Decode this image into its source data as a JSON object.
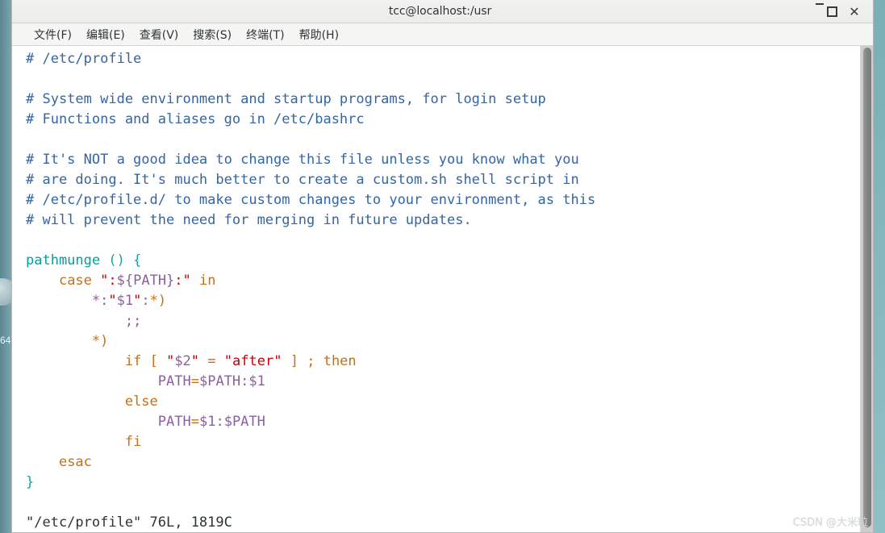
{
  "desktop": {
    "icon_label": "64",
    "icon_name": "desktop-disk-icon"
  },
  "window": {
    "title": "tcc@localhost:/usr",
    "controls": {
      "minimize": "minimize",
      "maximize": "maximize",
      "close": "close"
    }
  },
  "menu": {
    "items": [
      {
        "label": "文件(F)",
        "name": "menu-file"
      },
      {
        "label": "编辑(E)",
        "name": "menu-edit"
      },
      {
        "label": "查看(V)",
        "name": "menu-view"
      },
      {
        "label": "搜索(S)",
        "name": "menu-search"
      },
      {
        "label": "终端(T)",
        "name": "menu-terminal"
      },
      {
        "label": "帮助(H)",
        "name": "menu-help"
      }
    ]
  },
  "terminal": {
    "editor": "vim",
    "file": "/etc/profile",
    "status_line": "\"/etc/profile\" 76L, 1819C",
    "lines": [
      {
        "id": 1,
        "text": "# /etc/profile"
      },
      {
        "id": 2,
        "text": ""
      },
      {
        "id": 3,
        "text": "# System wide environment and startup programs, for login setup"
      },
      {
        "id": 4,
        "text": "# Functions and aliases go in /etc/bashrc"
      },
      {
        "id": 5,
        "text": ""
      },
      {
        "id": 6,
        "text": "# It's NOT a good idea to change this file unless you know what you"
      },
      {
        "id": 7,
        "text": "# are doing. It's much better to create a custom.sh shell script in"
      },
      {
        "id": 8,
        "text": "# /etc/profile.d/ to make custom changes to your environment, as this"
      },
      {
        "id": 9,
        "text": "# will prevent the need for merging in future updates."
      },
      {
        "id": 10,
        "text": ""
      },
      {
        "id": 11,
        "text": "pathmunge () {"
      },
      {
        "id": 12,
        "text": "    case \":${PATH}:\" in"
      },
      {
        "id": 13,
        "text": "        *:\"$1\":*)"
      },
      {
        "id": 14,
        "text": "            ;;"
      },
      {
        "id": 15,
        "text": "        *)"
      },
      {
        "id": 16,
        "text": "            if [ \"$2\" = \"after\" ] ; then"
      },
      {
        "id": 17,
        "text": "                PATH=$PATH:$1"
      },
      {
        "id": 18,
        "text": "            else"
      },
      {
        "id": 19,
        "text": "                PATH=$1:$PATH"
      },
      {
        "id": 20,
        "text": "            fi"
      },
      {
        "id": 21,
        "text": "    esac"
      },
      {
        "id": 22,
        "text": "}"
      },
      {
        "id": 23,
        "text": ""
      }
    ],
    "tokens": [
      [
        {
          "t": "# /etc/profile",
          "c": "tok-comment"
        }
      ],
      [
        {
          "t": "",
          "c": "tok-plain"
        }
      ],
      [
        {
          "t": "# System wide environment and startup programs, for login setup",
          "c": "tok-comment"
        }
      ],
      [
        {
          "t": "# Functions and aliases go in /etc/bashrc",
          "c": "tok-comment"
        }
      ],
      [
        {
          "t": "",
          "c": "tok-plain"
        }
      ],
      [
        {
          "t": "# It's NOT a good idea to change this file unless you know what you",
          "c": "tok-comment"
        }
      ],
      [
        {
          "t": "# are doing. It's much better to create a custom.sh shell script in",
          "c": "tok-comment"
        }
      ],
      [
        {
          "t": "# /etc/profile.d/ to make custom changes to your environment, as this",
          "c": "tok-comment"
        }
      ],
      [
        {
          "t": "# will prevent the need for merging in future updates.",
          "c": "tok-comment"
        }
      ],
      [
        {
          "t": "",
          "c": "tok-plain"
        }
      ],
      [
        {
          "t": "pathmunge",
          "c": "tok-func"
        },
        {
          "t": " ",
          "c": "tok-plain"
        },
        {
          "t": "() {",
          "c": "tok-paren"
        }
      ],
      [
        {
          "t": "    ",
          "c": "tok-plain"
        },
        {
          "t": "case",
          "c": "tok-keyword"
        },
        {
          "t": " ",
          "c": "tok-plain"
        },
        {
          "t": "\":",
          "c": "tok-string"
        },
        {
          "t": "${PATH}",
          "c": "tok-var"
        },
        {
          "t": ":\"",
          "c": "tok-string"
        },
        {
          "t": " ",
          "c": "tok-plain"
        },
        {
          "t": "in",
          "c": "tok-keyword"
        }
      ],
      [
        {
          "t": "        ",
          "c": "tok-plain"
        },
        {
          "t": "*:",
          "c": "tok-punct"
        },
        {
          "t": "\"",
          "c": "tok-string"
        },
        {
          "t": "$1",
          "c": "tok-var"
        },
        {
          "t": "\"",
          "c": "tok-string"
        },
        {
          "t": ":",
          "c": "tok-punct"
        },
        {
          "t": "*)",
          "c": "tok-keyword"
        }
      ],
      [
        {
          "t": "            ",
          "c": "tok-plain"
        },
        {
          "t": ";;",
          "c": "tok-punct"
        }
      ],
      [
        {
          "t": "        ",
          "c": "tok-plain"
        },
        {
          "t": "*)",
          "c": "tok-keyword"
        }
      ],
      [
        {
          "t": "            ",
          "c": "tok-plain"
        },
        {
          "t": "if",
          "c": "tok-keyword"
        },
        {
          "t": " ",
          "c": "tok-plain"
        },
        {
          "t": "[",
          "c": "tok-keyword"
        },
        {
          "t": " ",
          "c": "tok-plain"
        },
        {
          "t": "\"",
          "c": "tok-string"
        },
        {
          "t": "$2",
          "c": "tok-var"
        },
        {
          "t": "\"",
          "c": "tok-string"
        },
        {
          "t": " ",
          "c": "tok-plain"
        },
        {
          "t": "=",
          "c": "tok-op"
        },
        {
          "t": " ",
          "c": "tok-plain"
        },
        {
          "t": "\"after\"",
          "c": "tok-string"
        },
        {
          "t": " ",
          "c": "tok-plain"
        },
        {
          "t": "]",
          "c": "tok-keyword"
        },
        {
          "t": " ",
          "c": "tok-plain"
        },
        {
          "t": ";",
          "c": "tok-keyword"
        },
        {
          "t": " ",
          "c": "tok-plain"
        },
        {
          "t": "then",
          "c": "tok-keyword"
        }
      ],
      [
        {
          "t": "                ",
          "c": "tok-plain"
        },
        {
          "t": "PATH",
          "c": "tok-var"
        },
        {
          "t": "=",
          "c": "tok-op"
        },
        {
          "t": "$PATH",
          "c": "tok-var"
        },
        {
          "t": ":",
          "c": "tok-var"
        },
        {
          "t": "$1",
          "c": "tok-var"
        }
      ],
      [
        {
          "t": "            ",
          "c": "tok-plain"
        },
        {
          "t": "else",
          "c": "tok-keyword"
        }
      ],
      [
        {
          "t": "                ",
          "c": "tok-plain"
        },
        {
          "t": "PATH",
          "c": "tok-var"
        },
        {
          "t": "=",
          "c": "tok-op"
        },
        {
          "t": "$1",
          "c": "tok-var"
        },
        {
          "t": ":",
          "c": "tok-var"
        },
        {
          "t": "$PATH",
          "c": "tok-var"
        }
      ],
      [
        {
          "t": "            ",
          "c": "tok-plain"
        },
        {
          "t": "fi",
          "c": "tok-keyword"
        }
      ],
      [
        {
          "t": "    ",
          "c": "tok-plain"
        },
        {
          "t": "esac",
          "c": "tok-keyword"
        }
      ],
      [
        {
          "t": "}",
          "c": "tok-paren"
        }
      ],
      [
        {
          "t": "",
          "c": "tok-plain"
        }
      ],
      [
        {
          "t": "\"/etc/profile\" 76L, 1819C",
          "c": "tok-status"
        }
      ]
    ]
  },
  "scrollbar": {
    "position": "top",
    "name": "vertical-scrollbar"
  },
  "watermark": {
    "text": "CSDN @大米粒"
  },
  "colors": {
    "comment": "#3465a4",
    "keyword": "#c4701a",
    "string": "#cc0000",
    "variable": "#8b5fa0",
    "function": "#00a0a0",
    "background": "#ffffff",
    "desktop": "#6fa4ad"
  }
}
